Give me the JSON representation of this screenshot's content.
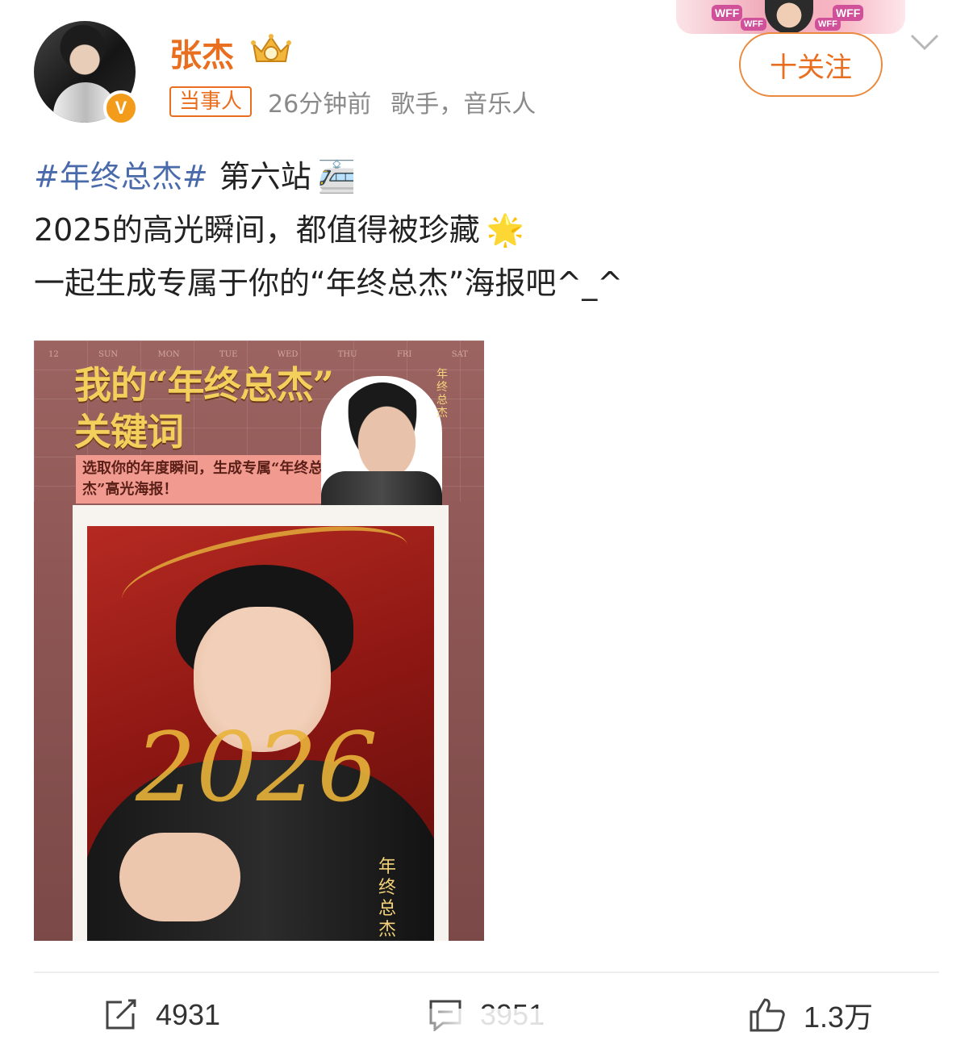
{
  "author": {
    "name": "张杰",
    "role_tag": "当事人",
    "time": "26分钟前",
    "description": "歌手，音乐人",
    "verified_glyph": "V"
  },
  "top_banner": {
    "tags": [
      "WFF",
      "WFF",
      "WFF",
      "WFF"
    ]
  },
  "follow_button": {
    "label": "十关注"
  },
  "post": {
    "hashtag": "#年终总杰#",
    "line1_text": "第六站",
    "line1_emoji": "🚈",
    "line2_text": "2025的高光瞬间，都值得被珍藏",
    "line2_emoji": "🌟",
    "line3_text": "一起生成专属于你的“年终总杰”海报吧^_^"
  },
  "poster": {
    "title_line1": "我的“年终总杰”",
    "title_line2": "关键词",
    "subtitle": "选取你的年度瞬间，生成专属“年终总杰”高光海报！",
    "corner_mark": "年终总杰",
    "calendar_heads": [
      "12",
      "SUN",
      "MON",
      "TUE",
      "WED",
      "THU",
      "FRI",
      "SAT"
    ],
    "signature_year": "2026",
    "photo_mark": "年终总杰"
  },
  "actions": {
    "repost_count": "4931",
    "comment_count": "3951",
    "like_count": "1.3万"
  },
  "colors": {
    "accent": "#ea6e1f",
    "link": "#4a6bab",
    "poster_gold": "#f3cf5b"
  },
  "icons": [
    "repost-icon",
    "comment-icon",
    "like-icon",
    "chevron-down-icon",
    "verified-icon",
    "crown-icon"
  ]
}
